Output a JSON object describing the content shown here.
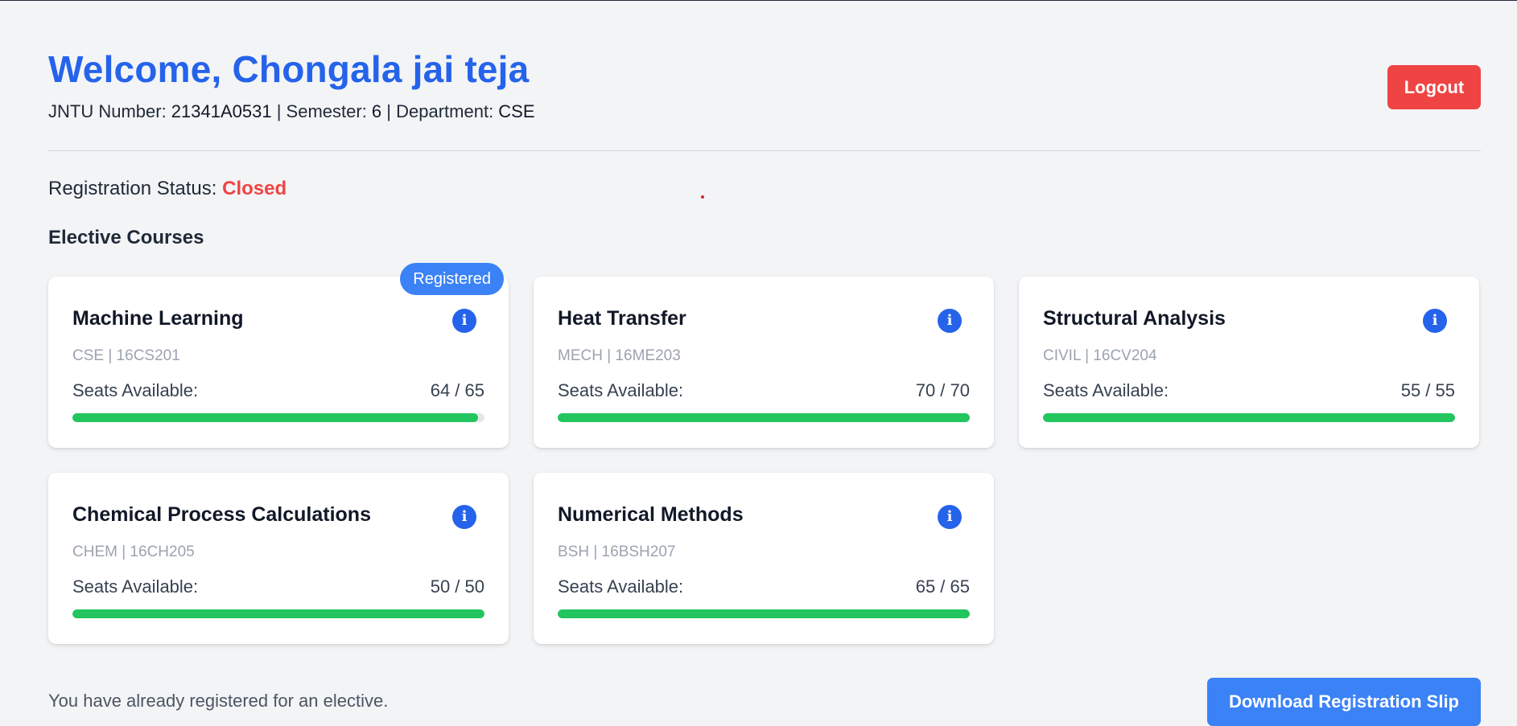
{
  "header": {
    "welcome": "Welcome, Chongala jai teja",
    "jntu_label": "JNTU Number: ",
    "jntu_value": "21341A0531",
    "sep1": " | ",
    "semester_label": "Semester: ",
    "semester_value": "6",
    "sep2": " | ",
    "department_label": "Department: ",
    "department_value": "CSE",
    "logout_label": "Logout"
  },
  "registration": {
    "status_label": "Registration Status: ",
    "status_value": "Closed"
  },
  "electives": {
    "title": "Elective Courses",
    "seats_label": "Seats Available:",
    "info_icon": "info-icon",
    "courses": [
      {
        "name": "Machine Learning",
        "dept_code": "CSE | 16CS201",
        "seats": "64 / 65",
        "fill_fraction": 0.985,
        "badge": "Registered"
      },
      {
        "name": "Heat Transfer",
        "dept_code": "MECH | 16ME203",
        "seats": "70 / 70",
        "fill_fraction": 1.0
      },
      {
        "name": "Structural Analysis",
        "dept_code": "CIVIL | 16CV204",
        "seats": "55 / 55",
        "fill_fraction": 1.0
      },
      {
        "name": "Chemical Process Calculations",
        "dept_code": "CHEM | 16CH205",
        "seats": "50 / 50",
        "fill_fraction": 1.0
      },
      {
        "name": "Numerical Methods",
        "dept_code": "BSH | 16BSH207",
        "seats": "65 / 65",
        "fill_fraction": 1.0
      }
    ]
  },
  "footer": {
    "note": "You have already registered for an elective.",
    "download_label": "Download Registration Slip"
  },
  "colors": {
    "primary": "#2563eb",
    "danger": "#ef4444",
    "success": "#22c55e",
    "badge": "#3b82f6",
    "background": "#f3f4f6"
  }
}
